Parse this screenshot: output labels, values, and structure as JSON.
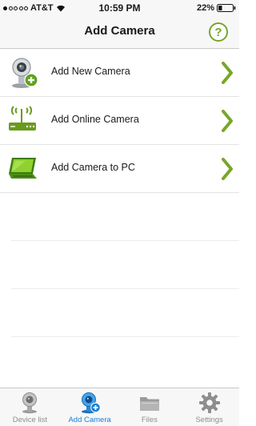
{
  "status_bar": {
    "carrier": "AT&T",
    "time": "10:59 PM",
    "battery": "22%"
  },
  "header": {
    "title": "Add Camera",
    "help_label": "?"
  },
  "list": {
    "items": [
      {
        "label": "Add New Camera",
        "icon": "webcam-add-icon"
      },
      {
        "label": "Add Online Camera",
        "icon": "router-icon"
      },
      {
        "label": "Add Camera to PC",
        "icon": "laptop-icon"
      }
    ]
  },
  "tabs": [
    {
      "label": "Device list",
      "icon": "webcam-icon",
      "active": false
    },
    {
      "label": "Add Camera",
      "icon": "add-camera-icon",
      "active": true
    },
    {
      "label": "Files",
      "icon": "folder-icon",
      "active": false
    },
    {
      "label": "Settings",
      "icon": "gear-icon",
      "active": false
    }
  ],
  "colors": {
    "accent_green": "#79a62a",
    "active_tab_blue": "#1a7fd4"
  }
}
